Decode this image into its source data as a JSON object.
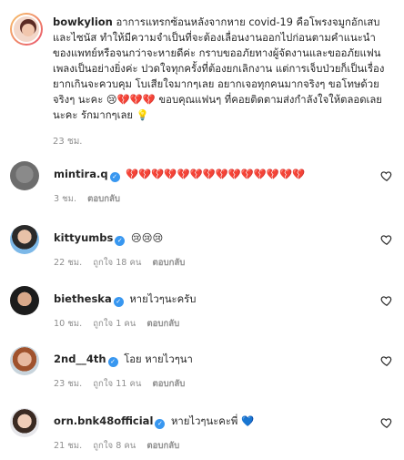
{
  "caption": {
    "username": "bowkylion",
    "text": "อาการแทรกซ้อนหลังจากหาย covid-19 คือโพรงจมูกอักเสบและไซนัส ทำให้มีความจำเป็นที่จะต้องเลื่อนงานออกไปก่อนตามคำแนะนำของแพทย์หรือจนกว่าจะหายดีค่ะ กราบขออภัยทางผู้จัดงานและขออภัยแฟนเพลงเป็นอย่างยิ่งค่ะ ปวดใจทุกครั้งที่ต้องยกเลิกงาน แต่การเจ็บป่วยก็เป็นเรื่องยากเกินจะควบคุม โบเสียใจมากๆเลย อยากเจอทุกคนมากจริงๆ ขอโทษด้วยจริงๆ นะคะ 😢💔💔💔 ขอบคุณแฟนๆ ที่คอยติดตามส่งกำลังใจให้ตลอดเลยนะคะ รักมากๆเลย 💡",
    "time": "23 ชม."
  },
  "comments": [
    {
      "username": "mintira.q",
      "verified": true,
      "text": "💔💔💔💔💔💔💔💔💔💔💔💔💔💔",
      "time": "3 ชม.",
      "likes": "",
      "reply": "ตอบกลับ"
    },
    {
      "username": "kittyumbs",
      "verified": true,
      "text": "😢😢😢",
      "time": "22 ชม.",
      "likes": "ถูกใจ 18 คน",
      "reply": "ตอบกลับ"
    },
    {
      "username": "bietheska",
      "verified": true,
      "text": "หายไวๆนะครับ",
      "time": "10 ชม.",
      "likes": "ถูกใจ 1 คน",
      "reply": "ตอบกลับ"
    },
    {
      "username": "2nd__4th",
      "verified": true,
      "text": "โอย หายไวๆนา",
      "time": "23 ชม.",
      "likes": "ถูกใจ 11 คน",
      "reply": "ตอบกลับ"
    },
    {
      "username": "orn.bnk48official",
      "verified": true,
      "text": "หายไวๆนะคะพี่ 💙",
      "time": "21 ชม.",
      "likes": "ถูกใจ 8 คน",
      "reply": "ตอบกลับ"
    }
  ],
  "colors": {
    "verified": "#3897f0",
    "muted": "#8e8e8e",
    "text": "#262626"
  }
}
